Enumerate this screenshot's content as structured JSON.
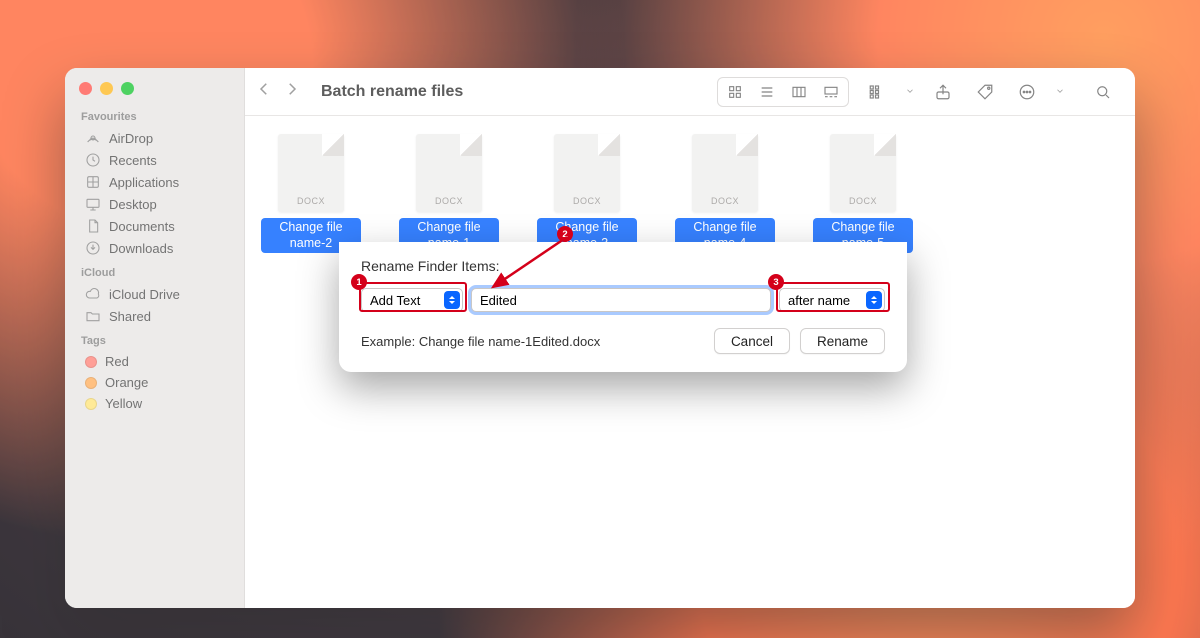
{
  "window": {
    "title": "Batch rename files"
  },
  "sidebar": {
    "sections": {
      "favourites": {
        "title": "Favourites",
        "items": [
          {
            "label": "AirDrop"
          },
          {
            "label": "Recents"
          },
          {
            "label": "Applications"
          },
          {
            "label": "Desktop"
          },
          {
            "label": "Documents"
          },
          {
            "label": "Downloads"
          }
        ]
      },
      "icloud": {
        "title": "iCloud",
        "items": [
          {
            "label": "iCloud Drive"
          },
          {
            "label": "Shared"
          }
        ]
      },
      "tags": {
        "title": "Tags",
        "items": [
          {
            "label": "Red",
            "color": "#ff8a80"
          },
          {
            "label": "Orange",
            "color": "#ffb366"
          },
          {
            "label": "Yellow",
            "color": "#ffe680"
          }
        ]
      }
    }
  },
  "files": [
    {
      "ext": "DOCX",
      "name": "Change file name-2"
    },
    {
      "ext": "DOCX",
      "name": "Change file name-1"
    },
    {
      "ext": "DOCX",
      "name": "Change file name-3"
    },
    {
      "ext": "DOCX",
      "name": "Change file name-4"
    },
    {
      "ext": "DOCX",
      "name": "Change file name-5"
    }
  ],
  "dialog": {
    "title": "Rename Finder Items:",
    "mode": "Add Text",
    "text_value": "Edited",
    "position": "after name",
    "example_prefix": "Example: ",
    "example_value": "Change file name-1Edited.docx",
    "cancel": "Cancel",
    "rename": "Rename"
  },
  "annotations": {
    "b1": "1",
    "b2": "2",
    "b3": "3"
  }
}
